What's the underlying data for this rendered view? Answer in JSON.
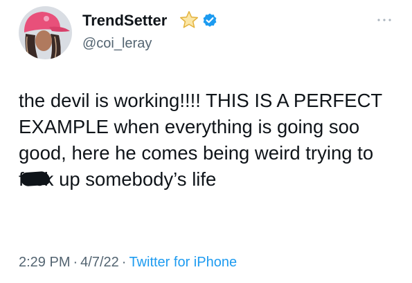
{
  "user": {
    "display_name": "TrendSetter",
    "handle": "@coi_leray",
    "badges": [
      "star-icon",
      "verified-icon"
    ]
  },
  "tweet": {
    "text_before": "the devil is working!!!! THIS IS A PERFECT EXAMPLE when everything is going soo good, here he comes being weird trying to ",
    "censored_word": "fuck",
    "text_after": " up somebody’s life"
  },
  "meta": {
    "time": "2:29 PM",
    "separator": "·",
    "date": "4/7/22",
    "source": "Twitter for iPhone"
  },
  "colors": {
    "text": "#0f1419",
    "secondary": "#536471",
    "link": "#1d9bf0",
    "verified": "#1d9bf0",
    "star": "#f5c542"
  }
}
